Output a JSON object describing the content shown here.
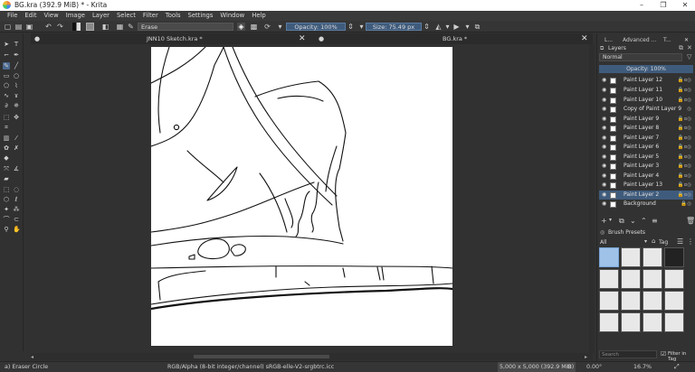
{
  "window": {
    "title": "BG.kra (392.9 MiB)  * - Krita"
  },
  "menu": [
    "File",
    "Edit",
    "View",
    "Image",
    "Layer",
    "Select",
    "Filter",
    "Tools",
    "Settings",
    "Window",
    "Help"
  ],
  "toolbar": {
    "blend_mode": "Erase",
    "opacity": "Opacity: 100%",
    "size": "Size: 75.49 px"
  },
  "tabs": [
    {
      "label": "JNN10 Sketch.kra *"
    },
    {
      "label": "BG.kra *"
    }
  ],
  "docker": {
    "tabs": [
      "L...",
      "Advanced ...",
      "T..."
    ],
    "layers_title": "Layers",
    "blend_mode": "Normal",
    "opacity": "Opacity:  100%",
    "layers": [
      {
        "name": "Paint Layer 12"
      },
      {
        "name": "Paint Layer 11"
      },
      {
        "name": "Paint Layer 10"
      },
      {
        "name": "Copy of Paint Layer 9"
      },
      {
        "name": "Paint Layer 9"
      },
      {
        "name": "Paint Layer 8"
      },
      {
        "name": "Paint Layer 7"
      },
      {
        "name": "Paint Layer 6"
      },
      {
        "name": "Paint Layer 5"
      },
      {
        "name": "Paint Layer 3"
      },
      {
        "name": "Paint Layer 4"
      },
      {
        "name": "Paint Layer 13"
      },
      {
        "name": "Paint Layer 2",
        "selected": true
      },
      {
        "name": "Background"
      }
    ],
    "brush_presets_title": "Brush Presets",
    "preset_filter": "All",
    "tag_label": "Tag",
    "search_placeholder": "Search",
    "filter_in_tag": "Filter in Tag"
  },
  "status": {
    "tool": "a) Eraser Circle",
    "color_space": "RGB/Alpha (8-bit integer/channel)  sRGB-elle-V2-srgbtrc.icc",
    "dimensions": "5,000 x 5,000 (392.9 MiB)",
    "rotation": "0.00°",
    "zoom": "16.7%"
  },
  "colors": {
    "accent": "#3f5b7c",
    "panel": "#323232",
    "canvas": "#313131"
  }
}
